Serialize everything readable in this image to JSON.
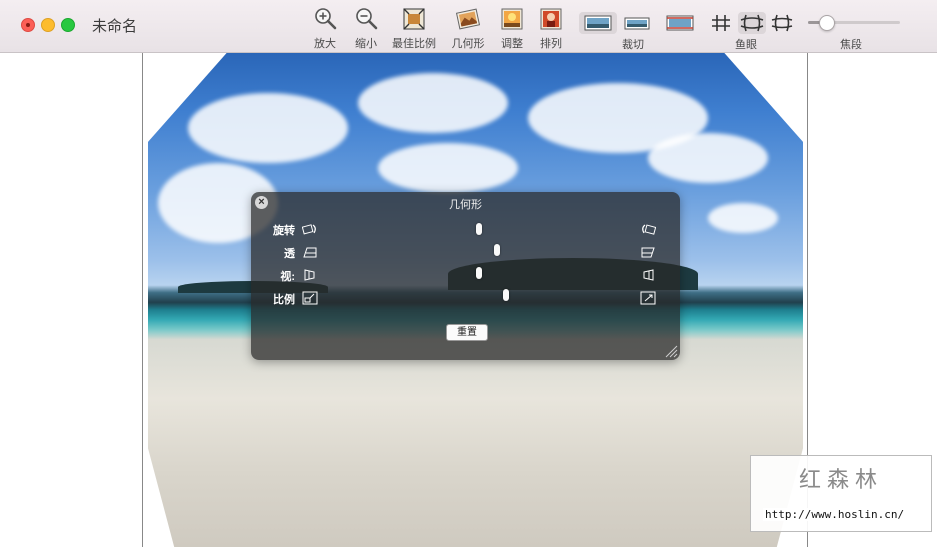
{
  "window": {
    "title": "未命名"
  },
  "toolbar": {
    "zoom_in": "放大",
    "zoom_out": "缩小",
    "best_fit": "最佳比例",
    "geometry": "几何形",
    "adjust": "调整",
    "arrange": "排列",
    "crop": "裁切",
    "fisheye": "鱼眼",
    "focal": "焦段"
  },
  "focal_slider": {
    "value_fraction": 0.2
  },
  "geometry_panel": {
    "title": "几何形",
    "rows": [
      {
        "label": "旋转",
        "value_fraction": 0.5
      },
      {
        "label": "透",
        "value_fraction": 0.56
      },
      {
        "label": "视:",
        "value_fraction": 0.5
      },
      {
        "label": "比例",
        "value_fraction": 0.59
      }
    ],
    "reset_label": "重置"
  },
  "watermark": {
    "brand": "红森林",
    "url": "http://www.hoslin.cn/"
  },
  "colors": {
    "toolbar_bg": "#f0eaed",
    "panel_bg": "#282828"
  }
}
